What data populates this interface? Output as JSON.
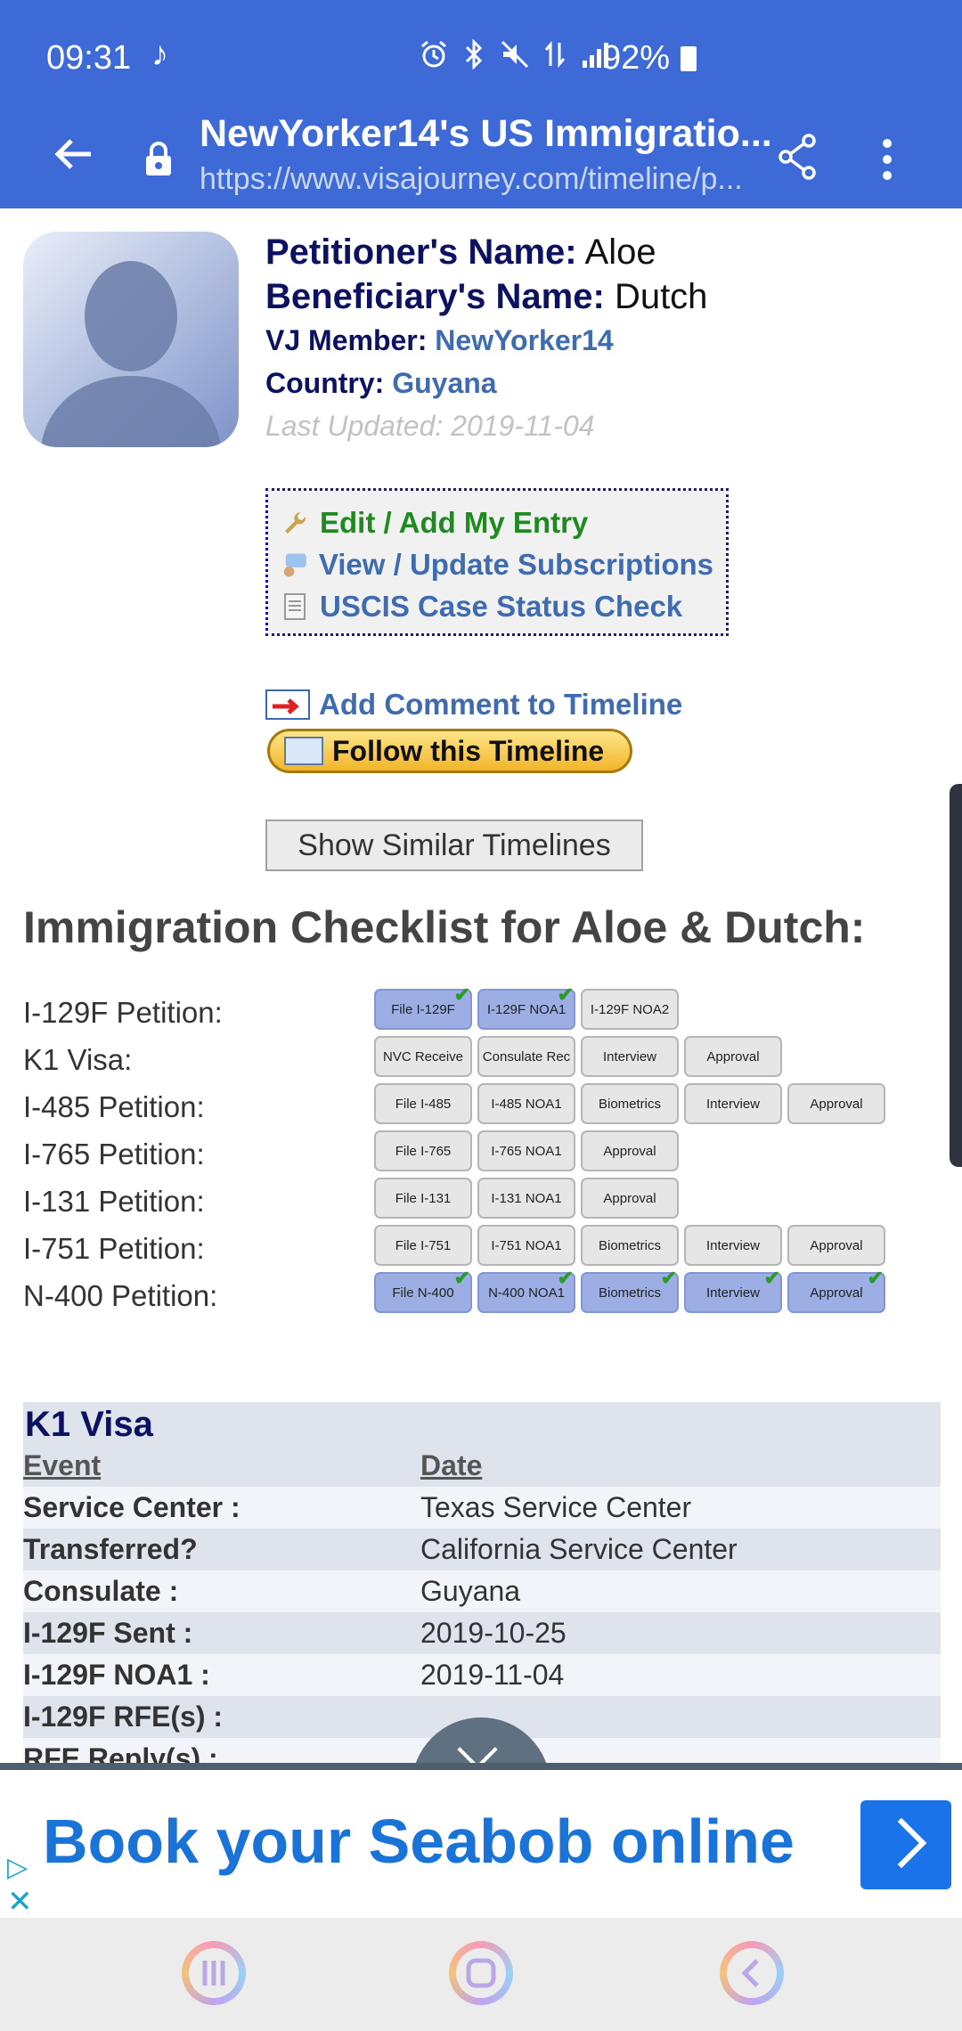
{
  "status_bar": {
    "time": "09:31",
    "battery": "92%"
  },
  "toolbar": {
    "title": "NewYorker14's US Immigratio...",
    "url": "https://www.visajourney.com/timeline/p..."
  },
  "profile": {
    "petitioner_label": "Petitioner's Name:",
    "petitioner": "Aloe",
    "beneficiary_label": "Beneficiary's Name:",
    "beneficiary": "Dutch",
    "member_label": "VJ Member:",
    "member": "NewYorker14",
    "country_label": "Country:",
    "country": "Guyana",
    "last_updated": "Last Updated: 2019-11-04"
  },
  "links": {
    "edit": "Edit / Add My Entry",
    "view": "View / Update Subscriptions",
    "uscis": "USCIS Case Status Check",
    "add_comment": "Add Comment to Timeline",
    "follow": "Follow this Timeline",
    "similar": "Show Similar Timelines"
  },
  "checklist": {
    "title": "Immigration Checklist for Aloe & Dutch:",
    "rows": [
      {
        "label": "I-129F Petition:",
        "steps": [
          {
            "t": "File I-129F",
            "done": true
          },
          {
            "t": "I-129F NOA1",
            "done": true
          },
          {
            "t": "I-129F NOA2",
            "done": false
          }
        ]
      },
      {
        "label": "K1 Visa:",
        "steps": [
          {
            "t": "NVC Receive",
            "done": false
          },
          {
            "t": "Consulate Rec",
            "done": false
          },
          {
            "t": "Interview",
            "done": false
          },
          {
            "t": "Approval",
            "done": false
          }
        ]
      },
      {
        "label": "I-485 Petition:",
        "steps": [
          {
            "t": "File I-485",
            "done": false
          },
          {
            "t": "I-485 NOA1",
            "done": false
          },
          {
            "t": "Biometrics",
            "done": false
          },
          {
            "t": "Interview",
            "done": false
          },
          {
            "t": "Approval",
            "done": false
          }
        ]
      },
      {
        "label": "I-765 Petition:",
        "steps": [
          {
            "t": "File I-765",
            "done": false
          },
          {
            "t": "I-765 NOA1",
            "done": false
          },
          {
            "t": "Approval",
            "done": false
          }
        ]
      },
      {
        "label": "I-131 Petition:",
        "steps": [
          {
            "t": "File I-131",
            "done": false
          },
          {
            "t": "I-131 NOA1",
            "done": false
          },
          {
            "t": "Approval",
            "done": false
          }
        ]
      },
      {
        "label": "I-751 Petition:",
        "steps": [
          {
            "t": "File I-751",
            "done": false
          },
          {
            "t": "I-751 NOA1",
            "done": false
          },
          {
            "t": "Biometrics",
            "done": false
          },
          {
            "t": "Interview",
            "done": false
          },
          {
            "t": "Approval",
            "done": false
          }
        ]
      },
      {
        "label": "N-400 Petition:",
        "steps": [
          {
            "t": "File N-400",
            "done": true
          },
          {
            "t": "N-400 NOA1",
            "done": true
          },
          {
            "t": "Biometrics",
            "done": true
          },
          {
            "t": "Interview",
            "done": true
          },
          {
            "t": "Approval",
            "done": true
          }
        ]
      }
    ]
  },
  "k1_section": {
    "heading": "K1 Visa",
    "col_event": "Event",
    "col_date": "Date",
    "rows": [
      {
        "event": "Service Center :",
        "date": "Texas Service Center"
      },
      {
        "event": "Transferred?",
        "date": "California Service Center"
      },
      {
        "event": "Consulate :",
        "date": "Guyana"
      },
      {
        "event": "I-129F Sent :",
        "date": "2019-10-25"
      },
      {
        "event": "I-129F NOA1 :",
        "date": "2019-11-04"
      },
      {
        "event": "I-129F RFE(s) :",
        "date": ""
      },
      {
        "event": "RFE Reply(s) :",
        "date": ""
      }
    ]
  },
  "ad": {
    "text": "Book your Seabob online"
  },
  "colors": {
    "header_blue": "#3d6ad6",
    "navy": "#0c1160",
    "link_blue": "#3f6bb0",
    "green": "#1f8a1f",
    "ad_blue": "#1a73e8"
  }
}
